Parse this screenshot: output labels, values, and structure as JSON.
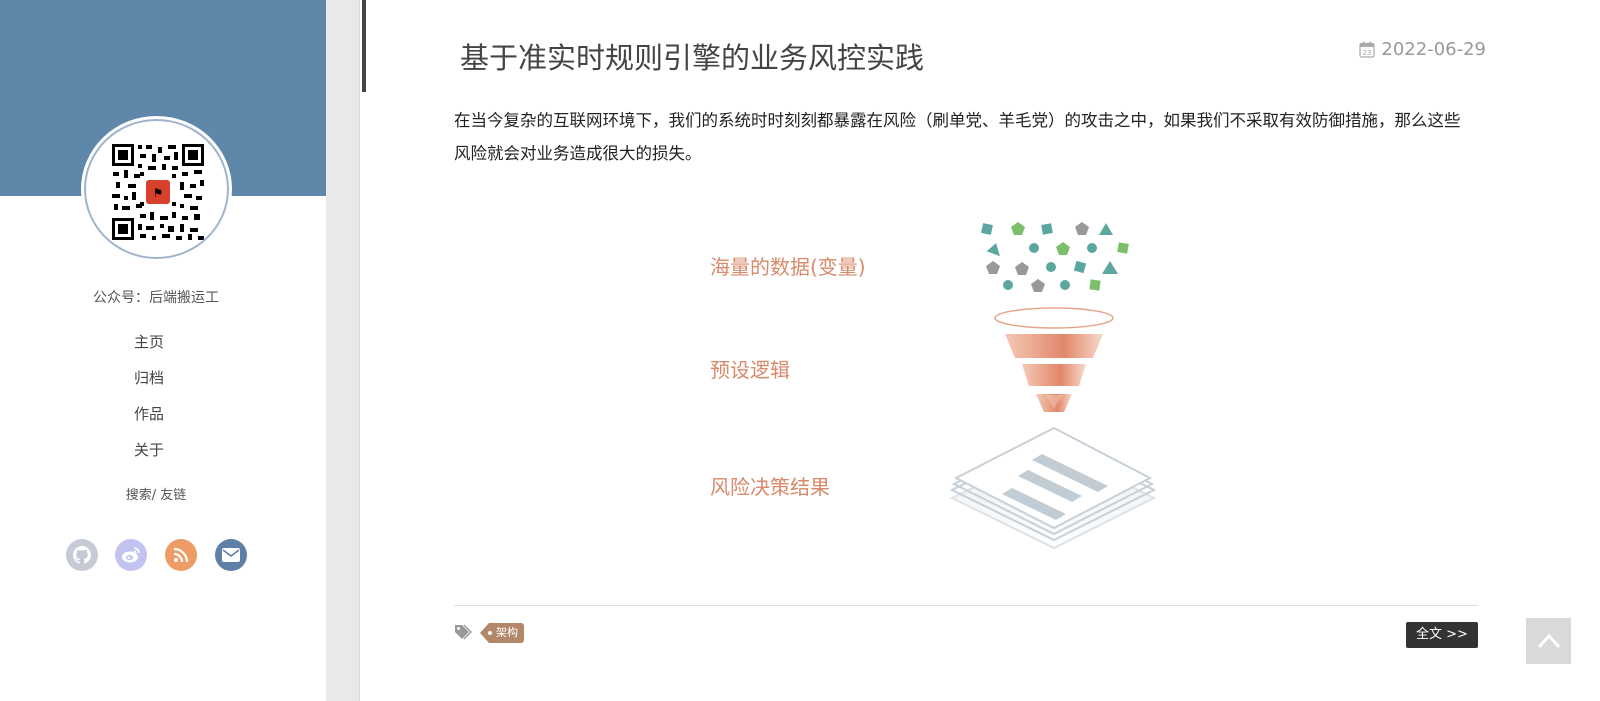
{
  "sidebar": {
    "site_name": "公众号：后端搬运工",
    "nav": [
      {
        "label": "主页"
      },
      {
        "label": "归档"
      },
      {
        "label": "作品"
      },
      {
        "label": "关于"
      }
    ],
    "search_link": "搜索/ 友链",
    "social": [
      {
        "icon": "github-icon",
        "color": "#c5cad4"
      },
      {
        "icon": "weibo-icon",
        "color": "#c3c3f2"
      },
      {
        "icon": "rss-icon",
        "color": "#ee9c66"
      },
      {
        "icon": "mail-icon",
        "color": "#5f7fa6"
      }
    ]
  },
  "post": {
    "title": "基于准实时规则引擎的业务风控实践",
    "date": "2022-06-29",
    "excerpt": "在当今复杂的互联网环境下，我们的系统时时刻刻都暴露在风险（刷单党、羊毛党）的攻击之中，如果我们不采取有效防御措施，那么这些风险就会对业务造成很大的损失。",
    "figure": {
      "label_data": "海量的数据(变量)",
      "label_logic": "预设逻辑",
      "label_result": "风险决策结果"
    },
    "tags": [
      {
        "label": "架构"
      }
    ],
    "read_more": "全文 >>"
  },
  "colors": {
    "banner": "#5f87aa",
    "accent_label": "#d9896a",
    "tag": "#b3876a"
  }
}
